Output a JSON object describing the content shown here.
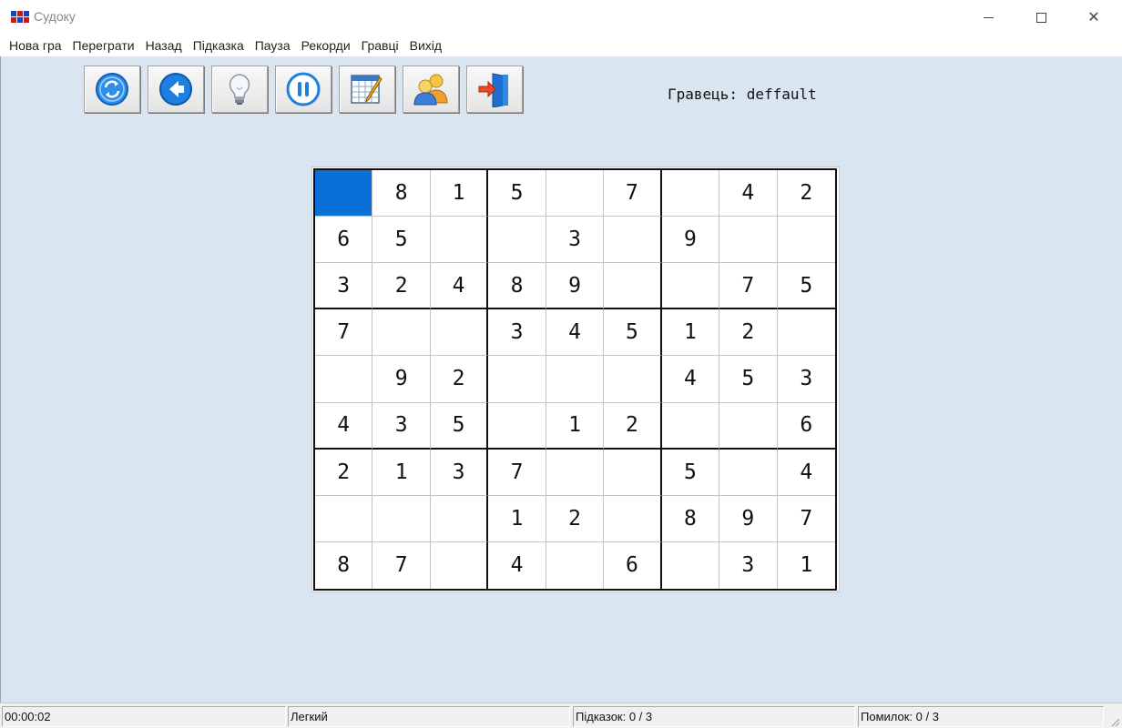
{
  "window": {
    "title": "Судоку",
    "icon": "sudoku-app-icon",
    "minimize_icon": "minimize-icon",
    "maximize_icon": "maximize-icon",
    "close_icon": "close-icon",
    "close_glyph": "✕"
  },
  "menu": {
    "items": [
      "Нова гра",
      "Переграти",
      "Назад",
      "Підказка",
      "Пауза",
      "Рекорди",
      "Гравці",
      "Вихід"
    ]
  },
  "toolbar": {
    "buttons": [
      {
        "name": "restart-button",
        "icon": "restart-icon"
      },
      {
        "name": "back-button",
        "icon": "back-arrow-icon"
      },
      {
        "name": "hint-button",
        "icon": "lightbulb-icon"
      },
      {
        "name": "pause-button",
        "icon": "pause-icon"
      },
      {
        "name": "records-button",
        "icon": "records-icon"
      },
      {
        "name": "players-button",
        "icon": "players-icon"
      },
      {
        "name": "exit-button",
        "icon": "exit-door-icon"
      }
    ],
    "accent": "#1f7fe0"
  },
  "player": {
    "label": "Гравець: deffault"
  },
  "board": {
    "selected_cell": [
      0,
      0
    ],
    "selected_color": "#0a6fd6",
    "rows": [
      [
        "",
        "8",
        "1",
        "5",
        "",
        "7",
        "",
        "4",
        "2"
      ],
      [
        "6",
        "5",
        "",
        "",
        "3",
        "",
        "9",
        "",
        ""
      ],
      [
        "3",
        "2",
        "4",
        "8",
        "9",
        "",
        "",
        "7",
        "5"
      ],
      [
        "7",
        "",
        "",
        "3",
        "4",
        "5",
        "1",
        "2",
        ""
      ],
      [
        "",
        "9",
        "2",
        "",
        "",
        "",
        "4",
        "5",
        "3"
      ],
      [
        "4",
        "3",
        "5",
        "",
        "1",
        "2",
        "",
        "",
        "6"
      ],
      [
        "2",
        "1",
        "3",
        "7",
        "",
        "",
        "5",
        "",
        "4"
      ],
      [
        "",
        "",
        "",
        "1",
        "2",
        "",
        "8",
        "9",
        "7"
      ],
      [
        "8",
        "7",
        "",
        "4",
        "",
        "6",
        "",
        "3",
        "1"
      ]
    ]
  },
  "status": {
    "time": "00:00:02",
    "difficulty": "Легкий",
    "hints": "Підказок: 0 / 3",
    "errors": "Помилок: 0 / 3"
  },
  "colors": {
    "client_background": "#d9e5f1"
  }
}
